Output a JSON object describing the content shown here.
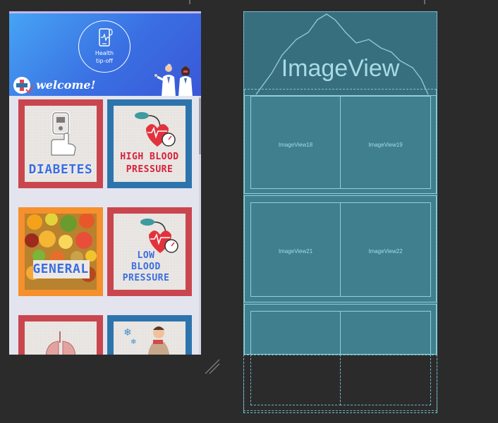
{
  "design_preview": {
    "header": {
      "logo_text": "Health\ntip-off",
      "welcome_text": "welcome!"
    },
    "cards": [
      {
        "label": "DIABETES",
        "frame": "red",
        "icon": "glucometer-hand-icon"
      },
      {
        "label": "HIGH BLOOD\nPRESSURE",
        "frame": "blue",
        "icon": "blood-pressure-gauge-icon"
      },
      {
        "label": "GENERAL",
        "frame": "orange",
        "icon": "fruits-image"
      },
      {
        "label": "LOW\nBLOOD\nPRESSURE",
        "frame": "red",
        "icon": "blood-pressure-gauge-icon"
      },
      {
        "label": "",
        "frame": "red",
        "icon": "lungs-image"
      },
      {
        "label": "",
        "frame": "blue",
        "icon": "cold-person-image"
      }
    ]
  },
  "blueprint": {
    "header_label": "ImageView",
    "cells": [
      "ImageView18",
      "ImageView19",
      "ImageView21",
      "ImageView22"
    ]
  },
  "colors": {
    "header_gradient_start": "#46a4f4",
    "header_gradient_end": "#3a57d8",
    "card_red": "#c9464f",
    "card_blue": "#2d74ad",
    "card_orange": "#f5902c",
    "card_text_blue": "#3c6de0",
    "card_text_red": "#d7213a",
    "blueprint_fill": "#3f7f8e",
    "canvas_bg": "#2b2b2c"
  }
}
